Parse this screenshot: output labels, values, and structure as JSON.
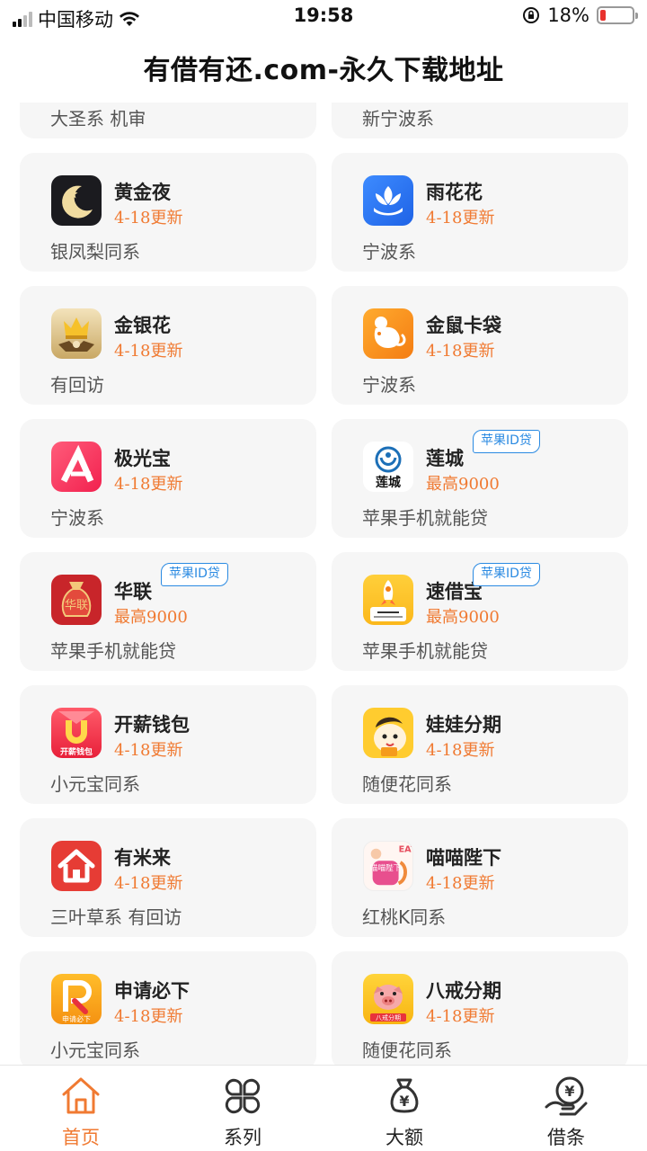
{
  "status": {
    "carrier": "中国移动",
    "time": "19:58",
    "battery": "18%",
    "battery_level": 0.18,
    "signal_bars": 2
  },
  "header": {
    "title": "有借有还.com-永久下载地址"
  },
  "partial": [
    {
      "desc": "大圣系 机审"
    },
    {
      "desc": "新宁波系"
    }
  ],
  "cards": [
    {
      "name": "黄金夜",
      "sub": "4-18更新",
      "desc": "银凤梨同系",
      "icon": "moon-star-icon",
      "tag": ""
    },
    {
      "name": "雨花花",
      "sub": "4-18更新",
      "desc": "宁波系",
      "icon": "lotus-icon",
      "tag": ""
    },
    {
      "name": "金银花",
      "sub": "4-18更新",
      "desc": "有回访",
      "icon": "crown-icon",
      "tag": ""
    },
    {
      "name": "金鼠卡袋",
      "sub": "4-18更新",
      "desc": "宁波系",
      "icon": "mouse-icon",
      "tag": ""
    },
    {
      "name": "极光宝",
      "sub": "4-18更新",
      "desc": "宁波系",
      "icon": "aurora-a-icon",
      "tag": ""
    },
    {
      "name": "莲城",
      "sub": "最高9000",
      "desc": "苹果手机就能贷",
      "icon": "liancheng-logo-icon",
      "tag": "苹果ID贷",
      "icon_text": "莲城"
    },
    {
      "name": "华联",
      "sub": "最高9000",
      "desc": "苹果手机就能贷",
      "icon": "money-bag-icon",
      "tag": "苹果ID贷",
      "icon_text": "华联"
    },
    {
      "name": "速借宝",
      "sub": "最高9000",
      "desc": "苹果手机就能贷",
      "icon": "rocket-icon",
      "tag": "苹果ID贷"
    },
    {
      "name": "开薪钱包",
      "sub": "4-18更新",
      "desc": "小元宝同系",
      "icon": "u-wallet-icon",
      "tag": "",
      "icon_text": "开薪钱包"
    },
    {
      "name": "娃娃分期",
      "sub": "4-18更新",
      "desc": "随便花同系",
      "icon": "baby-face-icon",
      "tag": ""
    },
    {
      "name": "有米来",
      "sub": "4-18更新",
      "desc": "三叶草系 有回访",
      "icon": "house-icon",
      "tag": ""
    },
    {
      "name": "喵喵陛下",
      "sub": "4-18更新",
      "desc": "红桃K同系",
      "icon": "cat-icon",
      "tag": "",
      "icon_text": "喵喵陛下"
    },
    {
      "name": "申请必下",
      "sub": "4-18更新",
      "desc": "小元宝同系",
      "icon": "r-logo-icon",
      "tag": "",
      "icon_text": "申请必下"
    },
    {
      "name": "八戒分期",
      "sub": "4-18更新",
      "desc": "随便花同系",
      "icon": "pig-icon",
      "tag": "",
      "icon_text": "八戒分期"
    }
  ],
  "tabs": [
    {
      "label": "首页",
      "icon": "home-icon",
      "active": true
    },
    {
      "label": "系列",
      "icon": "grid-icon",
      "active": false
    },
    {
      "label": "大额",
      "icon": "money-bag-icon",
      "active": false
    },
    {
      "label": "借条",
      "icon": "yen-hand-icon",
      "active": false
    }
  ],
  "colors": {
    "accent": "#f07a32",
    "tag_blue": "#2a8ae2",
    "card_bg": "#f6f6f6"
  }
}
